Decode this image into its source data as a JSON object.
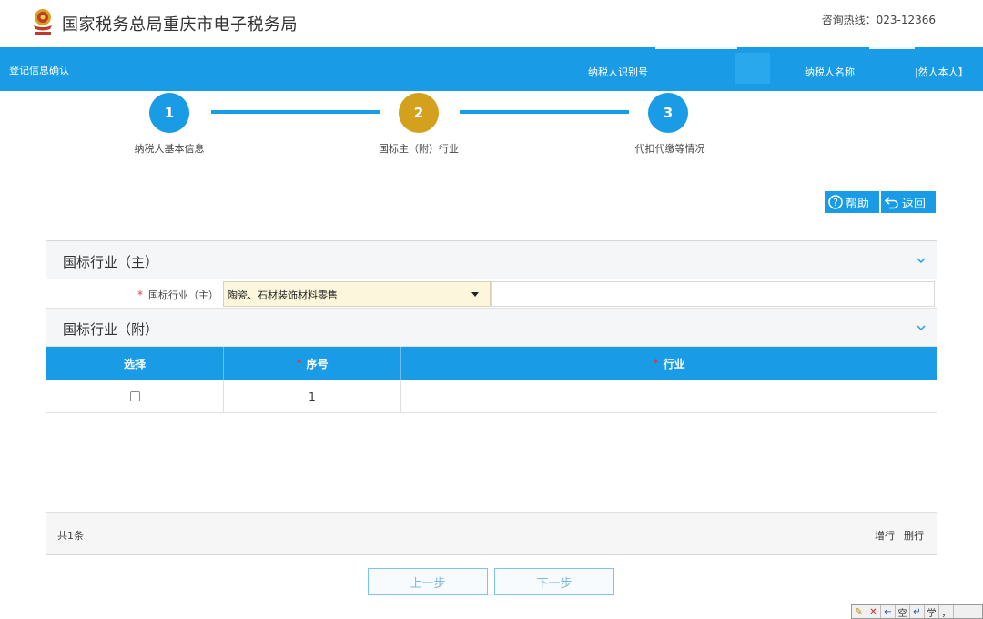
{
  "header": {
    "site_title": "国家税务总局重庆市电子税务局",
    "hotline": "咨询热线：023-12366"
  },
  "infobar": {
    "left_label": "登记信息确认",
    "taxpayer_id_label": "纳税人识别号",
    "taxpayer_name_label": "纳税人名称",
    "natural_person": "|然人本人】"
  },
  "steps": [
    {
      "number": "1",
      "label": "纳税人基本信息"
    },
    {
      "number": "2",
      "label": "国标主（附）行业"
    },
    {
      "number": "3",
      "label": "代扣代缴等情况"
    }
  ],
  "actions": {
    "help": "帮助",
    "back": "返回"
  },
  "main_section": {
    "title": "国标行业（主）",
    "field_label": "国标行业（主）",
    "field_value": "陶瓷、石材装饰材料零售"
  },
  "sub_section": {
    "title": "国标行业（附）",
    "columns": [
      "选择",
      "序号",
      "行业"
    ],
    "rows": [
      {
        "no": "1",
        "industry": ""
      }
    ],
    "total": "共1条",
    "add_row": "增行",
    "delete_row": "删行"
  },
  "nav": {
    "prev": "上一步",
    "next": "下一步"
  },
  "ime": [
    "✎",
    "✕",
    "←",
    "空",
    "↵",
    "学",
    "，"
  ],
  "colors": {
    "primary": "#1a9be6",
    "active_step": "#d4a11e",
    "select_bg": "#fcf6dc",
    "required": "#e23a3a"
  }
}
